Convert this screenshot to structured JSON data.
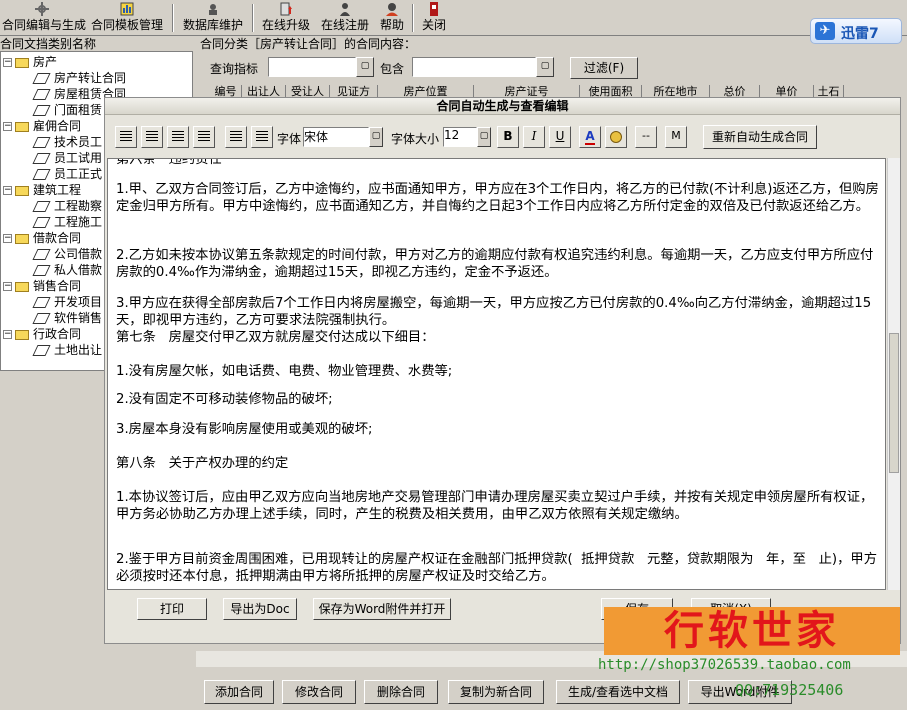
{
  "toolbar": {
    "items": [
      {
        "label": "合同编辑与生成",
        "icon": "gear-icon"
      },
      {
        "label": "合同模板管理",
        "icon": "chart-icon"
      },
      {
        "label": "数据库维护",
        "icon": "database-icon"
      },
      {
        "label": "在线升级",
        "icon": "upgrade-icon"
      },
      {
        "label": "在线注册",
        "icon": "register-icon"
      },
      {
        "label": "帮助",
        "icon": "help-icon"
      },
      {
        "label": "关闭",
        "icon": "close-icon"
      }
    ]
  },
  "brand": {
    "name": "迅雷7"
  },
  "tree": {
    "header": "合同文挡类别名称",
    "groups": [
      {
        "label": "房产",
        "items": [
          "房产转让合同",
          "房屋租赁合同",
          "门面租赁"
        ]
      },
      {
        "label": "雇佣合同",
        "items": [
          "技术员工",
          "员工试用",
          "员工正式"
        ]
      },
      {
        "label": "建筑工程",
        "items": [
          "工程勘察",
          "工程施工"
        ]
      },
      {
        "label": "借款合同",
        "items": [
          "公司借款",
          "私人借款"
        ]
      },
      {
        "label": "销售合同",
        "items": [
          "开发项目",
          "软件销售"
        ]
      },
      {
        "label": "行政合同",
        "items": [
          "土地出让"
        ]
      }
    ]
  },
  "content": {
    "header": "合同分类［房产转让合同］的合同内容：",
    "query_label": "查询指标",
    "query_value": "",
    "contains_label": "包含",
    "contains_value": "",
    "filter_button": "过滤(F)",
    "columns": [
      "编号",
      "出让人",
      "受让人",
      "见证方",
      "房产位置",
      "房产证号",
      "使用面积",
      "所在地市",
      "总价",
      "单价",
      "土石"
    ]
  },
  "dialog": {
    "title": "合同自动生成与查看编辑",
    "font_label": "字体",
    "font_value": "宋体",
    "size_label": "字体大小",
    "size_value": "12",
    "bold": "B",
    "italic": "I",
    "underline": "U",
    "dash_button": "--",
    "m_button": "M",
    "regen_button": "重新自动生成合同",
    "text": {
      "section6_partial": "第六条   违约责任",
      "p1": "1.甲、乙双方合同签订后，乙方中途悔约，应书面通知甲方，甲方应在3个工作日内，将乙方的已付款(不计利息)返还乙方，但购房定金归甲方所有。甲方中途悔约，应书面通知乙方，并自悔约之日起3个工作日内应将乙方所付定金的双倍及已付款返还给乙方。",
      "p2": "2.乙方如未按本协议第五条款规定的时间付款，甲方对乙方的逾期应付款有权追究违约利息。每逾期一天，乙方应支付甲方所应付房款的0.4‰作为滞纳金，逾期超过15天，即视乙方违约，定金不予返还。",
      "p3": "3.甲方应在获得全部房款后7个工作日内将房屋搬空，每逾期一天，甲方应按乙方已付房款的0.4‰向乙方付滞纳金，逾期超过15天，即视甲方违约，乙方可要求法院强制执行。",
      "s7": "第七条   房屋交付甲乙双方就房屋交付达成以下细目：",
      "s7_1": "1.没有房屋欠帐，如电话费、电费、物业管理费、水费等;",
      "s7_2": "2.没有固定不可移动装修物品的破坏;",
      "s7_3": "3.房屋本身没有影响房屋使用或美观的破坏;",
      "s8": "第八条   关于产权办理的约定",
      "s8_1": "1.本协议签订后，应由甲乙双方应向当地房地产交易管理部门申请办理房屋买卖立契过户手续，并按有关规定申领房屋所有权证，甲方务必协助乙方办理上述手续，同时，产生的税费及相关费用，由甲乙双方依照有关规定缴纳。",
      "s8_2": "2.鉴于甲方目前资金周围困难，已用现转让的房屋产权证在金融部门抵押贷款(  抵押贷款   元整，贷款期限为   年，至   止)，甲方必须按时还本付息，抵押期满由甲方将所抵押的房屋产权证及时交给乙方。"
    },
    "print_button": "打印",
    "export_doc_button": "导出为Doc",
    "save_word_button": "保存为Word附件并打开",
    "save_button": "保存",
    "cancel_button": "取消(X)"
  },
  "bottom": {
    "buttons": [
      "添加合同",
      "修改合同",
      "删除合同",
      "复制为新合同",
      "生成/查看选中文档",
      "导出Word附件"
    ]
  },
  "watermark": {
    "title": "行软世家",
    "url": "http://shop37026539.taobao.com",
    "qq": "QQ:719325406"
  }
}
